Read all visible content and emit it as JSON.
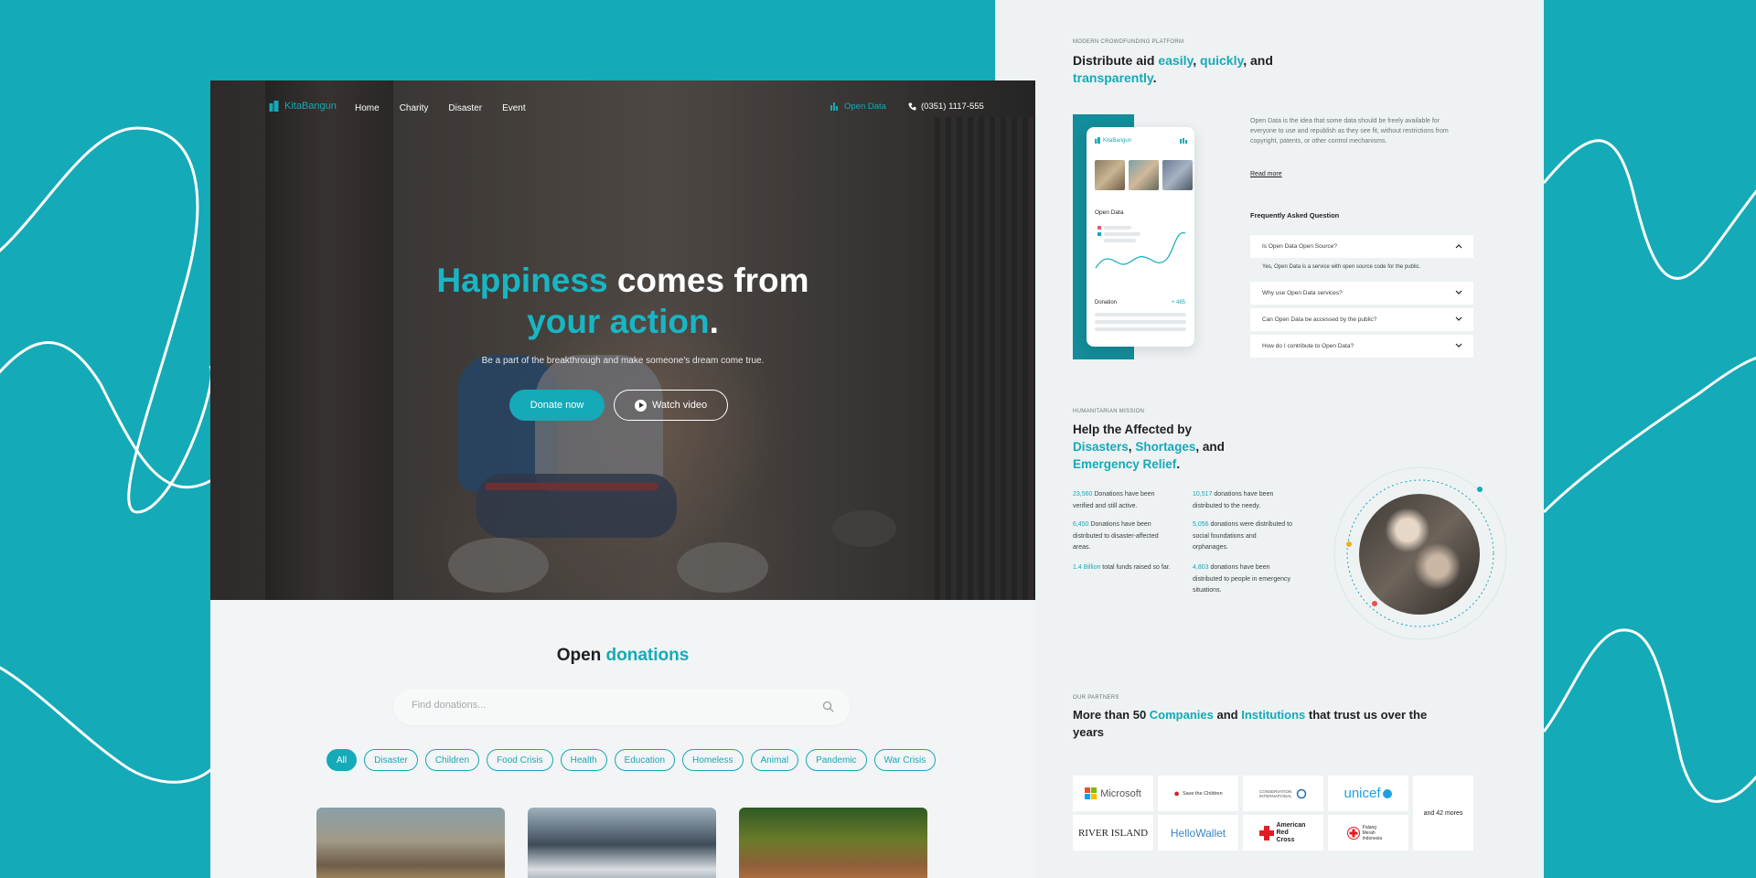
{
  "colors": {
    "accent": "#14aab8",
    "background": "#14aab8",
    "dark_text": "#1c1f24"
  },
  "nav": {
    "brand": "KitaBangun",
    "links": [
      "Home",
      "Charity",
      "Disaster",
      "Event"
    ],
    "open_data": "Open Data",
    "phone": "(0351) 1117-555"
  },
  "hero": {
    "title_accent_1": "Happiness",
    "title_plain_1": " comes from",
    "title_accent_2": "your action",
    "title_dot": ".",
    "subtitle": "Be a part of the breakthrough and make someone's dream come true.",
    "donate_label": "Donate now",
    "watch_label": "Watch video"
  },
  "donations": {
    "title_plain": "Open ",
    "title_accent": "donations",
    "search_placeholder": "Find donations...",
    "categories": [
      "All",
      "Disaster",
      "Children",
      "Food Crisis",
      "Health",
      "Education",
      "Homeless",
      "Animal",
      "Pandemic",
      "War Crisis"
    ]
  },
  "open_data": {
    "eyebrow": "MODERN CROWDFUNDING PLATFORM",
    "heading_1": "Distribute aid ",
    "heading_a1": "easily",
    "heading_c1": ", ",
    "heading_a2": "quickly",
    "heading_c2": ", and",
    "heading_a3": "transparently",
    "heading_dot": ".",
    "description": "Open Data is the idea that some data should be freely available for everyone to use and republish as they see fit, without restrictions from copyright, patents, or other control mechanisms.",
    "read_more": "Read more",
    "phone": {
      "brand": "KitaBangun",
      "chart_label": "Open Data",
      "donation_label": "Donation",
      "donation_value": "+ 485"
    },
    "faq_title": "Frequently Asked Question",
    "faq": [
      {
        "q": "Is Open Data Open Source?",
        "open": true,
        "a": "Yes, Open Data is a service with open source code for the public."
      },
      {
        "q": "Why use Open Data services?"
      },
      {
        "q": "Can Open Data be accessed by the public?"
      },
      {
        "q": "How do I contribute to Open Data?"
      }
    ]
  },
  "mission": {
    "eyebrow": "HUMANITARIAN MISSION",
    "heading_1": "Help the Affected by",
    "heading_a1": "Disasters",
    "heading_c1": ", ",
    "heading_a2": "Shortages",
    "heading_c2": ", and",
    "heading_a3": "Emergency Relief",
    "heading_dot": ".",
    "stats": [
      {
        "n": "23,560",
        "t": " Donations have been verified and still active."
      },
      {
        "n": "10,517",
        "t": " donations have been distributed to the needy."
      },
      {
        "n": "6,450",
        "t": " Donations have been distributed to disaster-affected areas."
      },
      {
        "n": "5,056",
        "t": " donations were distributed to social foundations and orphanages."
      },
      {
        "n": "1.4 Billion",
        "t": " total funds raised so far."
      },
      {
        "n": "4,803",
        "t": " donations have been distributed to people in emergency situations."
      }
    ]
  },
  "partners": {
    "eyebrow": "OUR PARTNERS",
    "heading_1": "More than 50 ",
    "heading_a1": "Companies",
    "heading_c1": " and ",
    "heading_a2": "Institutions",
    "heading_2": " that trust us over the years",
    "logos": [
      "Microsoft",
      "Save the Children",
      "CONSERVATION INTERNATIONAL",
      "unicef",
      "RIVER ISLAND",
      "HelloWallet",
      "American Red Cross",
      "Palang Merah Indonesia"
    ],
    "more": "and 42 mores"
  }
}
